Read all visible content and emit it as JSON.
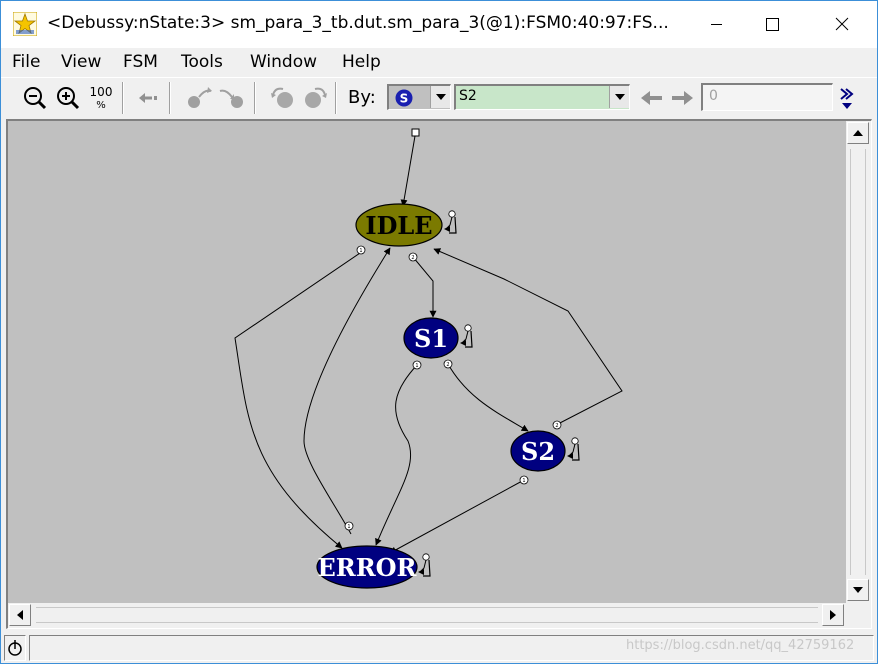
{
  "window": {
    "title": "<Debussy:nState:3> sm_para_3_tb.dut.sm_para_3(@1):FSM0:40:97:FS..."
  },
  "menu": {
    "items": [
      {
        "label": "File"
      },
      {
        "label": "View"
      },
      {
        "label": "FSM"
      },
      {
        "label": "Tools"
      },
      {
        "label": "Window"
      },
      {
        "label": "Help"
      }
    ]
  },
  "toolbar": {
    "zoom_100_label": "100",
    "zoom_100_sub": "%",
    "by_label": "By:",
    "by_icon": "S",
    "state_value": "S2",
    "number_value": "0"
  },
  "fsm": {
    "nodes": [
      {
        "id": "IDLE",
        "label": "IDLE",
        "color": "#7b7a00"
      },
      {
        "id": "S1",
        "label": "S1",
        "color": "#000080"
      },
      {
        "id": "S2",
        "label": "S2",
        "color": "#000080"
      },
      {
        "id": "ERROR",
        "label": "ERROR",
        "color": "#000080"
      }
    ],
    "edge_markers": [
      "1",
      "2",
      "1",
      "2",
      "1",
      "2",
      "1",
      "2",
      "1"
    ]
  },
  "watermark": "https://blog.csdn.net/qq_42759162",
  "colors": {
    "canvas_bg": "#c0c0c0",
    "accent_border": "#3c8fd8",
    "state_field_bg": "#c8e6c9"
  }
}
